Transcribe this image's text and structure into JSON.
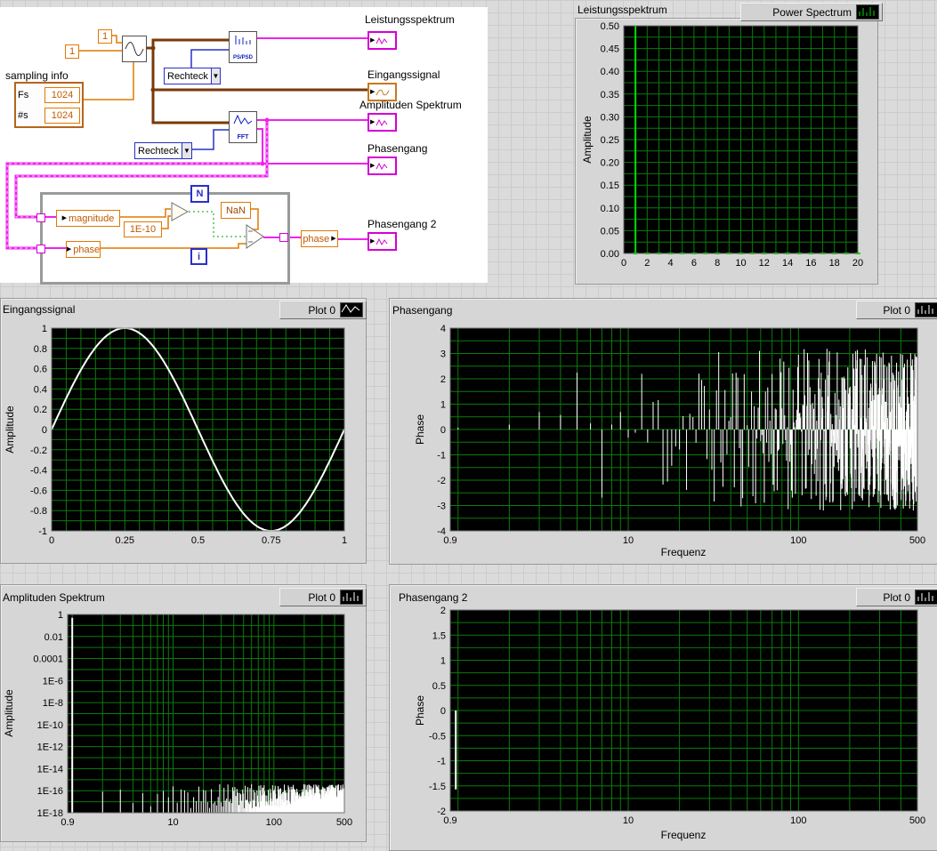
{
  "block_diagram": {
    "sampling_info": {
      "label": "sampling info",
      "fs_label": "Fs",
      "fs_value": "1024",
      "ns_label": "#s",
      "ns_value": "1024"
    },
    "const_top": "1",
    "const_left": "1",
    "dropdown1": "Rechteck",
    "dropdown2": "Rechteck",
    "ps_psd": "PS/PSD",
    "fft": "FFT",
    "nan": "NaN",
    "tolerance": "1E-10",
    "loop_n": "N",
    "loop_i": "i",
    "magnitude": "magnitude",
    "phase_in": "phase",
    "phase_out": "phase",
    "ind_leistung": "Leistungsspektrum",
    "ind_eingang": "Eingangssignal",
    "ind_amplituden": "Amplituden Spektrum",
    "ind_phasengang": "Phasengang",
    "ind_phasengang2": "Phasengang 2"
  },
  "chart_data": [
    {
      "type": "stem",
      "title": "Leistungsspektrum",
      "legend": "Power Spectrum",
      "legend_icon": "green-stems",
      "ylabel": "Amplitude",
      "xlabel": "",
      "x_scale": "linear",
      "y_scale": "linear",
      "xlim": [
        0,
        20
      ],
      "ylim": [
        0,
        0.5
      ],
      "x_minor": 1,
      "y_minor": 0.025,
      "grid_color": "#0c7a0c",
      "bg": "#000000",
      "x_ticks": [
        {
          "v": 0,
          "l": "0"
        },
        {
          "v": 2,
          "l": "2"
        },
        {
          "v": 4,
          "l": "4"
        },
        {
          "v": 6,
          "l": "6"
        },
        {
          "v": 8,
          "l": "8"
        },
        {
          "v": 10,
          "l": "10"
        },
        {
          "v": 12,
          "l": "12"
        },
        {
          "v": 14,
          "l": "14"
        },
        {
          "v": 16,
          "l": "16"
        },
        {
          "v": 18,
          "l": "18"
        },
        {
          "v": 20,
          "l": "20"
        }
      ],
      "y_ticks": [
        {
          "v": 0.5,
          "l": "0.50"
        },
        {
          "v": 0.45,
          "l": "0.45"
        },
        {
          "v": 0.4,
          "l": "0.40"
        },
        {
          "v": 0.35,
          "l": "0.35"
        },
        {
          "v": 0.3,
          "l": "0.30"
        },
        {
          "v": 0.25,
          "l": "0.25"
        },
        {
          "v": 0.2,
          "l": "0.20"
        },
        {
          "v": 0.15,
          "l": "0.15"
        },
        {
          "v": 0.1,
          "l": "0.10"
        },
        {
          "v": 0.05,
          "l": "0.05"
        },
        {
          "v": 0,
          "l": "0.00"
        }
      ],
      "series": [
        {
          "kind": "stems",
          "color": "#00dd00",
          "width": 2,
          "points": [
            [
              1,
              0.5
            ]
          ]
        },
        {
          "kind": "zero_dashes",
          "color": "#00dd00",
          "x_start": 1,
          "x_end": 20,
          "step": 1
        }
      ]
    },
    {
      "type": "line",
      "title": "Eingangssignal",
      "legend": "Plot 0",
      "legend_icon": "line",
      "ylabel": "Amplitude",
      "xlabel": "",
      "x_scale": "linear",
      "y_scale": "linear",
      "xlim": [
        0,
        1
      ],
      "ylim": [
        -1,
        1
      ],
      "x_minor": 0.05,
      "y_minor": 0.1,
      "grid_color": "#0c7a0c",
      "bg": "#000000",
      "x_ticks": [
        {
          "v": 0,
          "l": "0"
        },
        {
          "v": 0.25,
          "l": "0.25"
        },
        {
          "v": 0.5,
          "l": "0.5"
        },
        {
          "v": 0.75,
          "l": "0.75"
        },
        {
          "v": 1,
          "l": "1"
        }
      ],
      "y_ticks": [
        {
          "v": 1,
          "l": "1"
        },
        {
          "v": 0.8,
          "l": "0.8"
        },
        {
          "v": 0.6,
          "l": "0.6"
        },
        {
          "v": 0.4,
          "l": "0.4"
        },
        {
          "v": 0.2,
          "l": "0.2"
        },
        {
          "v": 0,
          "l": "0"
        },
        {
          "v": -0.2,
          "l": "-0.2"
        },
        {
          "v": -0.4,
          "l": "-0.4"
        },
        {
          "v": -0.6,
          "l": "-0.6"
        },
        {
          "v": -0.8,
          "l": "-0.8"
        },
        {
          "v": -1,
          "l": "-1"
        }
      ],
      "series": [
        {
          "kind": "sine",
          "amplitude": 1,
          "periods": 1,
          "n": 256,
          "color": "#ffffff",
          "width": 2
        }
      ]
    },
    {
      "type": "stem",
      "title": "Phasengang",
      "legend": "Plot 0",
      "legend_icon": "stems",
      "ylabel": "Phase",
      "xlabel": "Frequenz",
      "x_scale": "log",
      "y_scale": "linear",
      "xlim": [
        0.9,
        500
      ],
      "ylim": [
        -4,
        4
      ],
      "y_minor": 0.5,
      "grid_color": "#0c7a0c",
      "bg": "#000000",
      "x_ticks": [
        {
          "v": 0.9,
          "l": "0.9"
        },
        {
          "v": 10,
          "l": "10"
        },
        {
          "v": 100,
          "l": "100"
        },
        {
          "v": 500,
          "l": "500"
        }
      ],
      "y_ticks": [
        {
          "v": 4,
          "l": "4"
        },
        {
          "v": 3,
          "l": "3"
        },
        {
          "v": 2,
          "l": "2"
        },
        {
          "v": 1,
          "l": "1"
        },
        {
          "v": 0,
          "l": "0"
        },
        {
          "v": -1,
          "l": "-1"
        },
        {
          "v": -2,
          "l": "-2"
        },
        {
          "v": -3,
          "l": "-3"
        },
        {
          "v": -4,
          "l": "-4"
        }
      ],
      "series": [
        {
          "kind": "noise_stems",
          "seed": 11,
          "x_start": 1,
          "x_end": 500,
          "step": 1,
          "y_min": -3.2,
          "y_max": 3.2,
          "color": "#ffffff",
          "width": 1
        }
      ]
    },
    {
      "type": "stem",
      "title": "Amplituden Spektrum",
      "legend": "Plot 0",
      "legend_icon": "stems",
      "ylabel": "Amplitude",
      "xlabel": "",
      "x_scale": "log",
      "y_scale": "log",
      "xlim": [
        0.9,
        500
      ],
      "ylim": [
        1e-18,
        1
      ],
      "grid_color": "#0c7a0c",
      "bg": "#000000",
      "x_ticks": [
        {
          "v": 0.9,
          "l": "0.9"
        },
        {
          "v": 10,
          "l": "10"
        },
        {
          "v": 100,
          "l": "100"
        },
        {
          "v": 500,
          "l": "500"
        }
      ],
      "y_ticks": [
        {
          "v": 1,
          "l": "1"
        },
        {
          "v": 0.01,
          "l": "0.01"
        },
        {
          "v": 0.0001,
          "l": "0.0001"
        },
        {
          "v": 1e-06,
          "l": "1E-6"
        },
        {
          "v": 1e-08,
          "l": "1E-8"
        },
        {
          "v": 1e-10,
          "l": "1E-10"
        },
        {
          "v": 1e-12,
          "l": "1E-12"
        },
        {
          "v": 1e-14,
          "l": "1E-14"
        },
        {
          "v": 1e-16,
          "l": "1E-16"
        },
        {
          "v": 1e-18,
          "l": "1E-18"
        }
      ],
      "series": [
        {
          "kind": "stems",
          "color": "#ffffff",
          "width": 2,
          "points": [
            [
              1,
              0.5
            ]
          ]
        },
        {
          "kind": "log_noise_stems",
          "seed": 5,
          "x_start": 2,
          "x_end": 500,
          "step": 1,
          "exp_min": -17.6,
          "exp_max": -15.4,
          "color": "#ffffff",
          "width": 1
        }
      ]
    },
    {
      "type": "stem",
      "title": "Phasengang 2",
      "legend": "Plot 0",
      "legend_icon": "stems",
      "ylabel": "Phase",
      "xlabel": "Frequenz",
      "x_scale": "log",
      "y_scale": "linear",
      "xlim": [
        0.9,
        500
      ],
      "ylim": [
        -2,
        2
      ],
      "y_minor": 0.25,
      "grid_color": "#0c7a0c",
      "bg": "#000000",
      "x_ticks": [
        {
          "v": 0.9,
          "l": "0.9"
        },
        {
          "v": 10,
          "l": "10"
        },
        {
          "v": 100,
          "l": "100"
        },
        {
          "v": 500,
          "l": "500"
        }
      ],
      "y_ticks": [
        {
          "v": 2,
          "l": "2"
        },
        {
          "v": 1.5,
          "l": "1.5"
        },
        {
          "v": 1,
          "l": "1"
        },
        {
          "v": 0.5,
          "l": "0.5"
        },
        {
          "v": 0,
          "l": "0"
        },
        {
          "v": -0.5,
          "l": "-0.5"
        },
        {
          "v": -1,
          "l": "-1"
        },
        {
          "v": -1.5,
          "l": "-1.5"
        },
        {
          "v": -2,
          "l": "-2"
        }
      ],
      "series": [
        {
          "kind": "stems",
          "color": "#ffffff",
          "width": 2,
          "points": [
            [
              0.97,
              -1.57
            ]
          ]
        }
      ]
    }
  ]
}
